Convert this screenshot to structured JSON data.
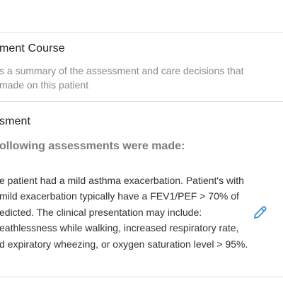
{
  "treatment_course": {
    "title": "ment Course",
    "summary_lines": [
      "s a summary of the assessment and care decisions that",
      "made on this patient"
    ]
  },
  "assessment": {
    "title": "sment",
    "subheading": "ollowing assessments were made:",
    "lines": [
      "e patient had a mild asthma exacerbation. Patient's with",
      "mild exacerbation typically have a FEV1/PEF > 70% of",
      "edicted. The clinical presentation may include:",
      "eathlessness while walking, increased respiratory rate,",
      "d expiratory wheezing, or oxygen saturation level > 95%."
    ]
  },
  "icons": {
    "edit": "pencil-icon"
  },
  "colors": {
    "accent": "#3a8fd0",
    "divider": "#e0e0e0"
  }
}
